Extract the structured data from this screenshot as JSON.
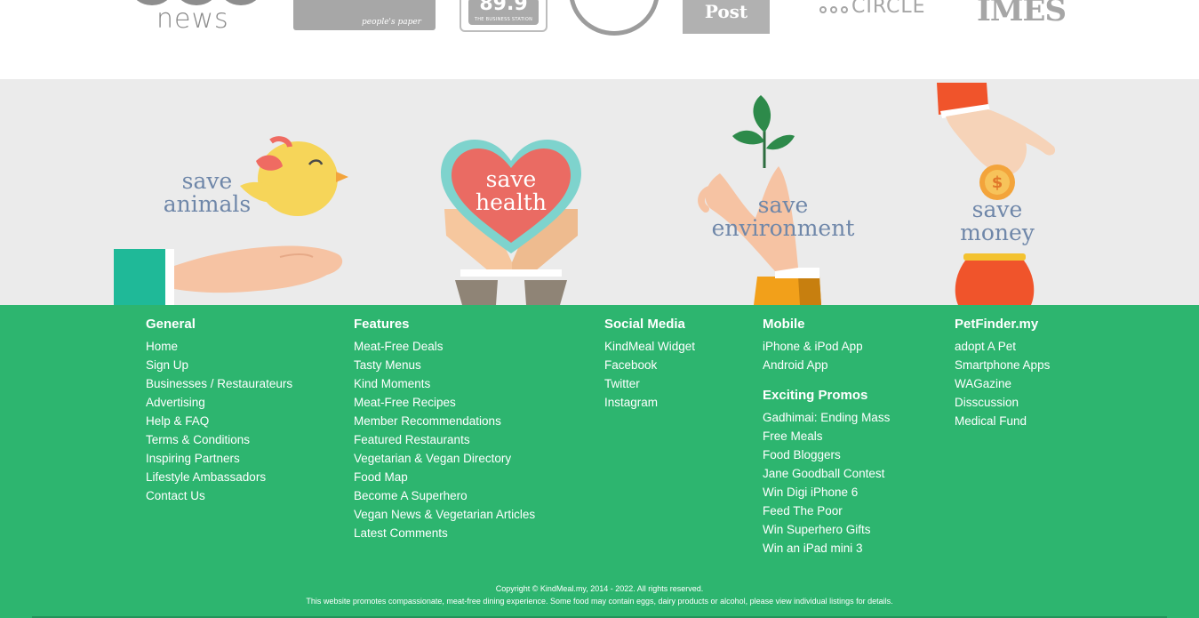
{
  "press": {
    "logos": [
      {
        "name": "news",
        "text": "news"
      },
      {
        "name": "star",
        "text": "people's paper"
      },
      {
        "name": "bfm",
        "text": "89.9",
        "caption": "THE BUSINESS STATION"
      },
      {
        "name": "ring",
        "text": ""
      },
      {
        "name": "post",
        "text": "Post"
      },
      {
        "name": "circle",
        "text": "CIRCLE"
      },
      {
        "name": "times",
        "text": "IMES"
      }
    ]
  },
  "causes": {
    "animals": {
      "line1": "save",
      "line2": "animals"
    },
    "health": {
      "line1": "save",
      "line2": "health"
    },
    "environment": {
      "line1": "save",
      "line2": "environment"
    },
    "money": {
      "line1": "save",
      "line2": "money"
    }
  },
  "footer": {
    "general": {
      "heading": "General",
      "links": [
        "Home",
        "Sign Up",
        "Businesses / Restaurateurs",
        "Advertising",
        "Help & FAQ",
        "Terms & Conditions",
        "Inspiring Partners",
        "Lifestyle Ambassadors",
        "Contact Us"
      ]
    },
    "features": {
      "heading": "Features",
      "links": [
        "Meat-Free Deals",
        "Tasty Menus",
        "Kind Moments",
        "Meat-Free Recipes",
        "Member Recommendations",
        "Featured Restaurants",
        "Vegetarian & Vegan Directory",
        "Food Map",
        "Become A Superhero",
        "Vegan News & Vegetarian Articles",
        "Latest Comments"
      ]
    },
    "social": {
      "heading": "Social Media",
      "links": [
        "KindMeal Widget",
        "Facebook",
        "Twitter",
        "Instagram"
      ]
    },
    "mobile": {
      "heading": "Mobile",
      "links": [
        "iPhone & iPod App",
        "Android App"
      ]
    },
    "promos": {
      "heading": "Exciting Promos",
      "links": [
        "Gadhimai: Ending Mass",
        "Free Meals",
        "Food Bloggers",
        "Jane Goodball Contest",
        "Win Digi iPhone 6",
        "Feed The Poor",
        "Win Superhero Gifts",
        "Win an iPad mini 3"
      ]
    },
    "petfinder": {
      "heading": "PetFinder.my",
      "links": [
        "adopt A Pet",
        "Smartphone Apps",
        "WAGazine",
        "Disscussion",
        "Medical Fund"
      ]
    },
    "copyright": "Copyright © KindMeal.my, 2014 - 2022. All rights reserved.",
    "disclaimer": "This website promotes compassionate, meat-free dining experience. Some food may contain eggs, dairy products or alcohol, please view individual listings for details."
  },
  "colors": {
    "footer_bg": "#2db56f",
    "band_bg": "#ebebeb",
    "label_blue": "#6f87a9",
    "heart": "#ea6b63",
    "heart_outline": "#7ed3cd"
  }
}
